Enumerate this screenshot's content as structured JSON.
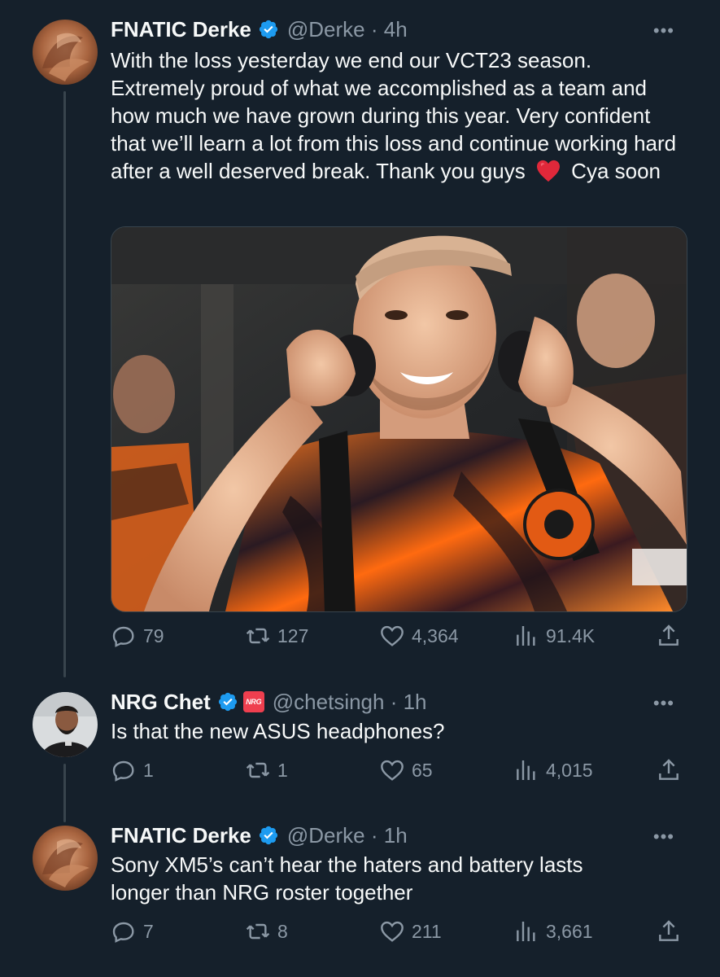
{
  "tweets": [
    {
      "name": "FNATIC Derke",
      "handle": "@Derke · 4h",
      "text_before_emoji": "With the loss yesterday we end our VCT23 season. Extremely proud of what we accomplished as a team and how much we have grown during this year. Very confident that we’ll learn a lot from this loss and continue working hard after a well deserved break. Thank you guys",
      "text_after_emoji": "Cya soon",
      "emoji": "red-heart",
      "has_media": true,
      "media_description_icon": "photo-player-with-headphones",
      "stats": {
        "replies": "79",
        "retweets": "127",
        "likes": "4,364",
        "views": "91.4K"
      }
    },
    {
      "name": "NRG Chet",
      "handle": "@chetsingh · 1h",
      "affiliate_badge": "NRG",
      "text": "Is that the new ASUS headphones?",
      "stats": {
        "replies": "1",
        "retweets": "1",
        "likes": "65",
        "views": "4,015"
      }
    },
    {
      "name": "FNATIC Derke",
      "handle": "@Derke · 1h",
      "text": "Sony XM5’s can’t hear the haters and battery lasts longer than NRG roster together",
      "stats": {
        "replies": "7",
        "retweets": "8",
        "likes": "211",
        "views": "3,661"
      }
    }
  ],
  "colors": {
    "background": "#15202b",
    "text_primary": "#f7f9f9",
    "text_secondary": "#8b98a5",
    "verified": "#1d9bf0",
    "thread_line": "#38444d"
  },
  "icons": {
    "reply": "reply-icon",
    "retweet": "retweet-icon",
    "like": "heart-icon",
    "views": "views-icon",
    "share": "share-icon",
    "more": "more-icon",
    "verified": "verified-badge-icon"
  }
}
